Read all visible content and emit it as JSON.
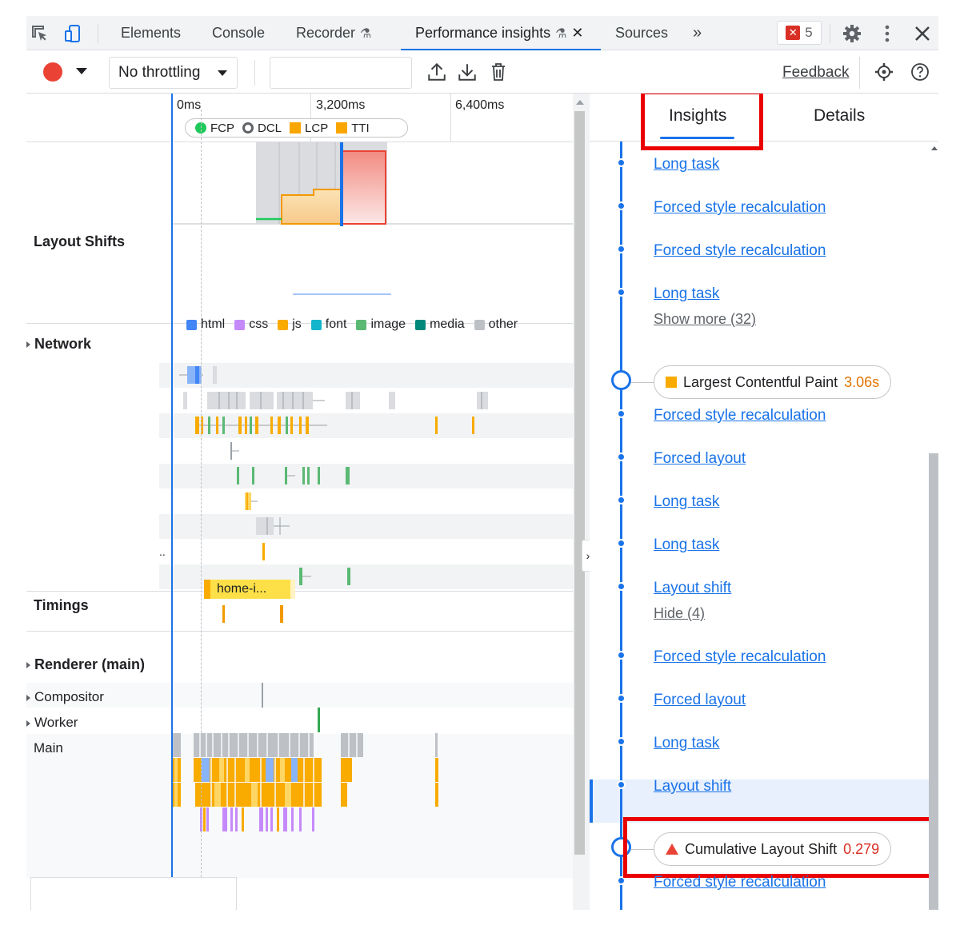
{
  "tabs": [
    {
      "label": "Elements"
    },
    {
      "label": "Console"
    },
    {
      "label": "Recorder"
    },
    {
      "label": "Performance insights"
    },
    {
      "label": "Sources"
    }
  ],
  "overflow_glyph": "»",
  "error_count": "5",
  "toolbar": {
    "throttling": "No throttling",
    "feedback": "Feedback"
  },
  "ruler": {
    "ticks": [
      "0ms",
      "3,200ms",
      "6,400ms"
    ],
    "legend": [
      {
        "label": "FCP",
        "color": "#1ec95a"
      },
      {
        "label": "DCL",
        "color": "#5f6368"
      },
      {
        "label": "LCP",
        "color": "#f9a600"
      },
      {
        "label": "TTI",
        "color": "#f9a600"
      }
    ]
  },
  "tracks": {
    "layout_shifts": "Layout Shifts",
    "network": "Network",
    "timings": "Timings",
    "timing_chip": "home-i...",
    "renderer": "Renderer (main)",
    "compositor": "Compositor",
    "worker": "Worker",
    "main": "Main",
    "network_ellipsis": ".."
  },
  "network_legend": [
    {
      "label": "html",
      "color": "#4285f4"
    },
    {
      "label": "css",
      "color": "#c58af9"
    },
    {
      "label": "js",
      "color": "#f9ab00"
    },
    {
      "label": "font",
      "color": "#12b5cb"
    },
    {
      "label": "image",
      "color": "#5bb974"
    },
    {
      "label": "media",
      "color": "#00897b"
    },
    {
      "label": "other",
      "color": "#bdc1c6"
    }
  ],
  "right_tabs": {
    "insights": "Insights",
    "details": "Details"
  },
  "insights": [
    {
      "label": "Long task"
    },
    {
      "label": "Forced style recalculation"
    },
    {
      "label": "Forced style recalculation"
    },
    {
      "label": "Long task"
    },
    {
      "label": "Show more (32)"
    },
    {
      "label": "Largest Contentful Paint",
      "value": "3.06s"
    },
    {
      "label": "Forced style recalculation"
    },
    {
      "label": "Forced layout"
    },
    {
      "label": "Long task"
    },
    {
      "label": "Long task"
    },
    {
      "label": "Layout shift"
    },
    {
      "label": "Hide (4)"
    },
    {
      "label": "Forced style recalculation"
    },
    {
      "label": "Forced layout"
    },
    {
      "label": "Long task"
    },
    {
      "label": "Layout shift"
    },
    {
      "label": "Cumulative Layout Shift",
      "value": "0.279"
    },
    {
      "label": "Forced style recalculation"
    }
  ],
  "colors": {
    "accent": "#1a73e8",
    "lcp_value": "#e37400",
    "cls_value": "#d93025",
    "highlight_box": "#ea0000"
  }
}
